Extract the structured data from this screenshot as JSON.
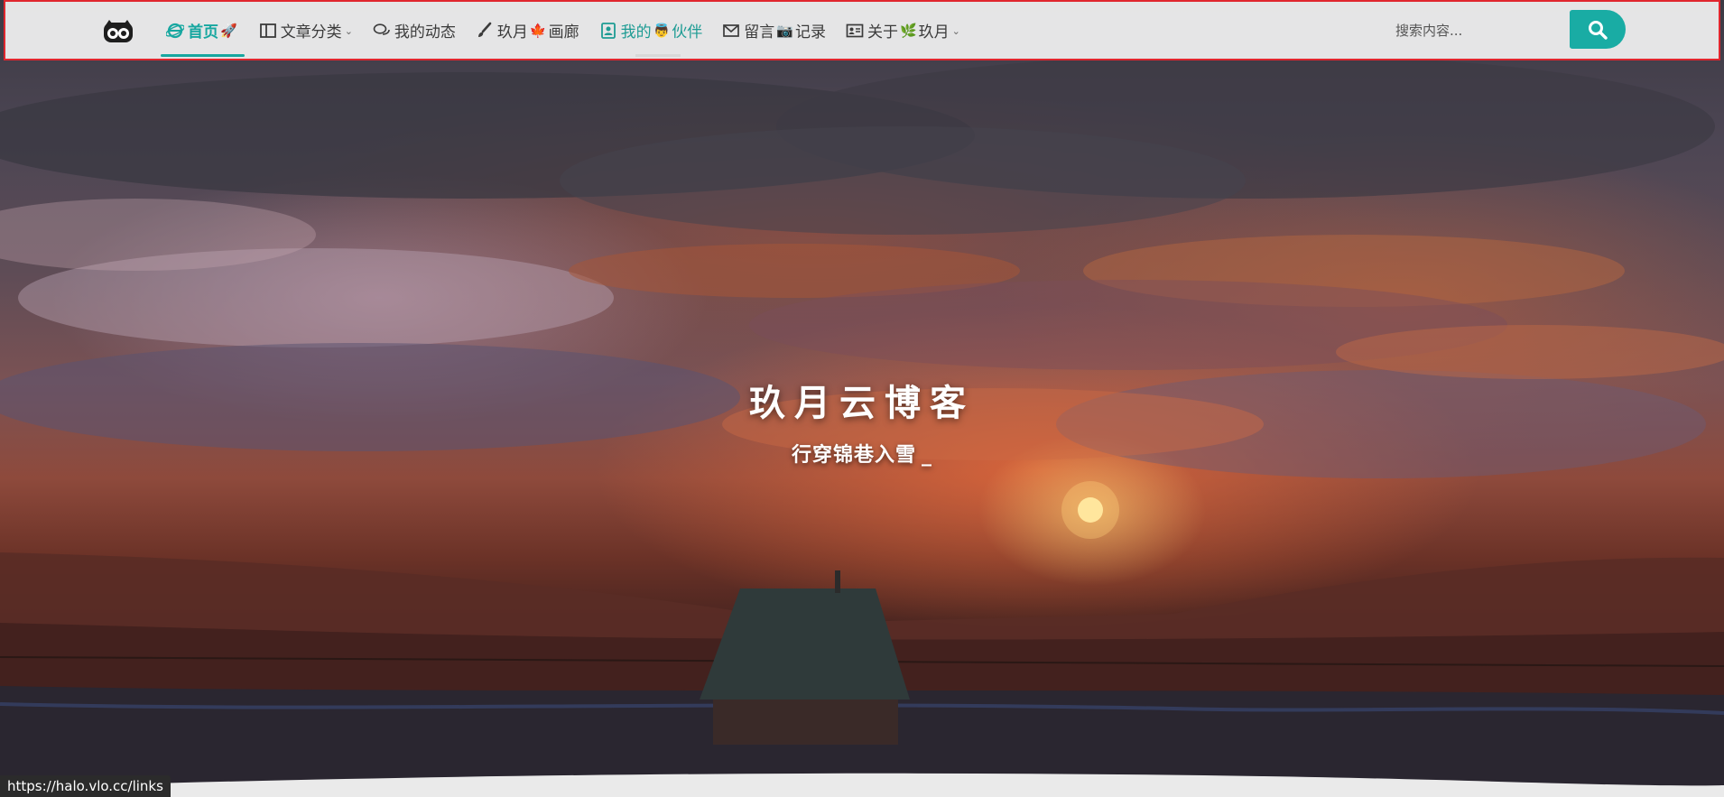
{
  "nav": {
    "items": [
      {
        "label": "首页",
        "emoji": "🚀",
        "icon": "ie-icon",
        "active": true
      },
      {
        "label": "文章分类",
        "icon": "columns-icon",
        "has_caret": true
      },
      {
        "label": "我的动态",
        "icon": "chat-bubbles-icon"
      },
      {
        "label": "玖月",
        "emoji": "🍁",
        "label2": "画廊",
        "icon": "brush-icon"
      },
      {
        "label": "我的",
        "emoji": "👼",
        "label2": "伙伴",
        "icon": "contact-card-icon"
      },
      {
        "label": "留言",
        "emoji": "📷",
        "label2": "记录",
        "icon": "envelope-icon"
      },
      {
        "label": "关于",
        "emoji": "🌿",
        "label2": "玖月",
        "icon": "id-card-icon",
        "has_caret": true
      }
    ]
  },
  "search": {
    "placeholder": "搜索内容...",
    "button_icon": "search-icon"
  },
  "hero": {
    "title": "玖月云博客",
    "subtitle": "行穿锦巷入雪",
    "cursor": "_"
  },
  "status_bar": {
    "url": "https://halo.vlo.cc/links"
  },
  "colors": {
    "accent": "#19aca4",
    "nav_border": "#e0262e",
    "nav_bg": "#ececec"
  }
}
